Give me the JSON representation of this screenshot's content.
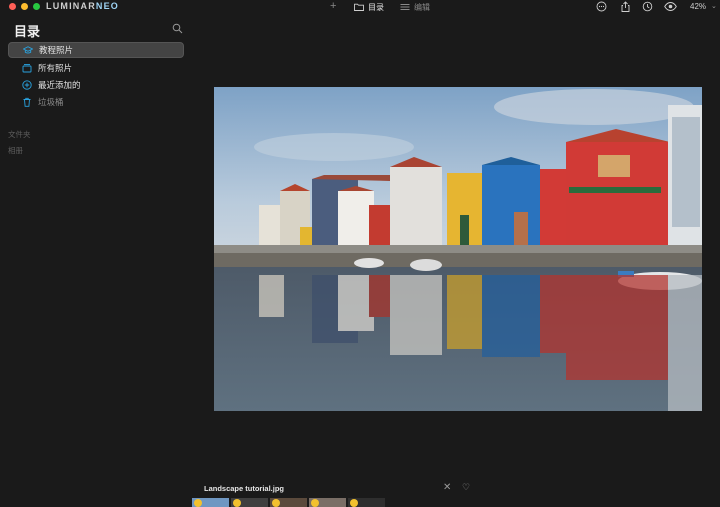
{
  "app": {
    "logo_main": "LUMINAR",
    "logo_neo": "NEO",
    "tabs": [
      {
        "label": "目录",
        "active": true
      },
      {
        "label": "编辑",
        "active": false
      }
    ],
    "zoom": "42%"
  },
  "sidebar": {
    "title": "目录",
    "items": [
      {
        "label": "教程照片",
        "icon": "graduation-cap-icon",
        "active": true
      },
      {
        "label": "所有照片",
        "icon": "photos-stack-icon",
        "active": false
      },
      {
        "label": "最近添加的",
        "icon": "add-circle-icon",
        "active": false
      },
      {
        "label": "垃圾桶",
        "icon": "trash-icon",
        "active": false
      }
    ],
    "sections": [
      "文件夹",
      "相册"
    ]
  },
  "viewer": {
    "filename": "Landscape tutorial.jpg"
  },
  "colors": {
    "accent": "#29a3e0",
    "background": "#1a1a1a",
    "active_item": "#444444"
  }
}
